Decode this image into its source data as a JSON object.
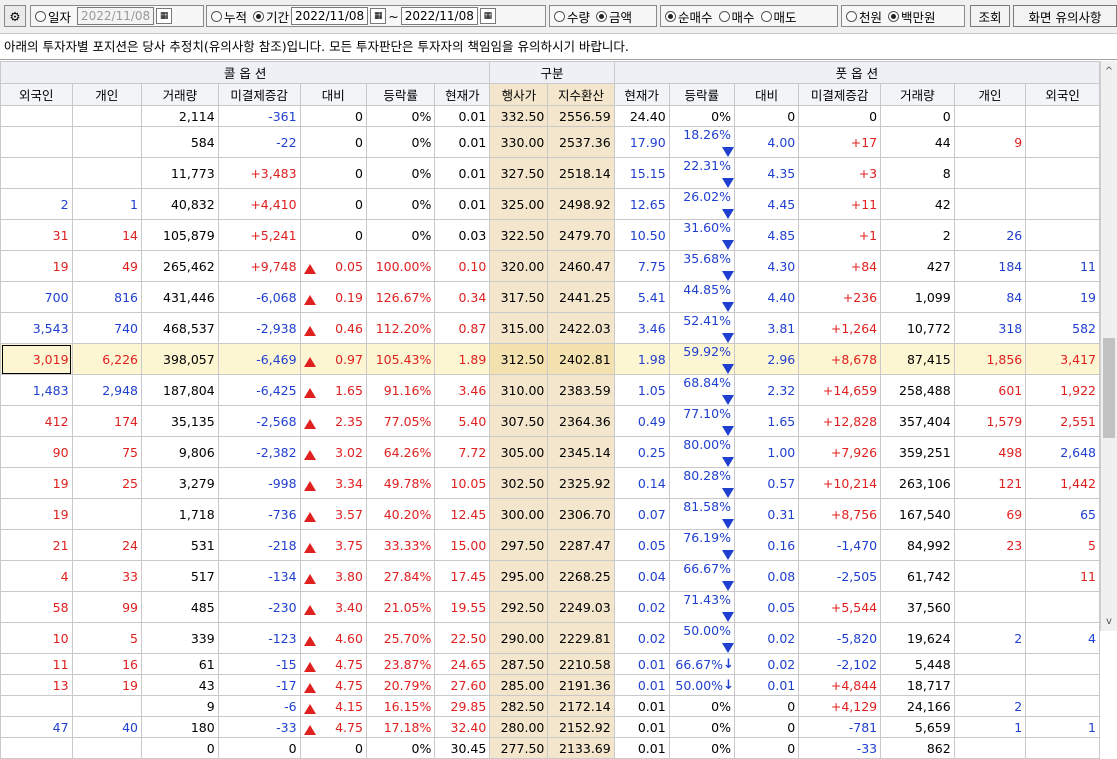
{
  "toolbar": {
    "gear_icon": "⚙",
    "period_daily": "일자",
    "date_single": "2022/11/08",
    "period_cumulative": "누적",
    "period_range": "기간",
    "date_from": "2022/11/08",
    "tilde": "~",
    "date_to": "2022/11/08",
    "unit_qty": "수량",
    "unit_amount": "금액",
    "trade_net": "순매수",
    "trade_buy": "매수",
    "trade_sell": "매도",
    "money_krw": "천원",
    "money_million": "백만원",
    "query_button": "조회",
    "notes_button": "화면 유의사항"
  },
  "notice": "아래의 투자자별 포지션은 당사 추정치(유의사항 참조)입니다. 모든 투자판단은 투자자의 책임임을 유의하시기 바랍니다.",
  "headers": {
    "call": "콜 옵 션",
    "mid": "구분",
    "put": "풋 옵 션",
    "cols": [
      "외국인",
      "개인",
      "거래량",
      "미결제증감",
      "대비",
      "등락률",
      "현재가",
      "행사가",
      "지수환산",
      "현재가",
      "등락률",
      "대비",
      "미결제증감",
      "거래량",
      "개인",
      "외국인"
    ]
  },
  "rows": [
    {
      "cf": "",
      "ci": "",
      "cv": "2,114",
      "coi": "-361",
      "cd": "0",
      "cdir": "",
      "cr": "0%",
      "cp": "0.01",
      "k": "332.50",
      "idx": "2556.59",
      "pp": "24.40",
      "pr": "0%",
      "pdir": "",
      "pd": "0",
      "poi": "0",
      "pv": "0",
      "pi": "",
      "pf": ""
    },
    {
      "cf": "",
      "ci": "",
      "cv": "584",
      "coi": "-22",
      "cd": "0",
      "cdir": "",
      "cr": "0%",
      "cp": "0.01",
      "k": "330.00",
      "idx": "2537.36",
      "pp": "17.90",
      "pr": "18.26%",
      "pdir": "down",
      "pd": "4.00",
      "poi": "+17",
      "pv": "44",
      "pi": "9",
      "pf": ""
    },
    {
      "cf": "",
      "ci": "",
      "cv": "11,773",
      "coi": "+3,483",
      "cd": "0",
      "cdir": "",
      "cr": "0%",
      "cp": "0.01",
      "k": "327.50",
      "idx": "2518.14",
      "pp": "15.15",
      "pr": "22.31%",
      "pdir": "down",
      "pd": "4.35",
      "poi": "+3",
      "pv": "8",
      "pi": "",
      "pf": ""
    },
    {
      "cf": "2",
      "ci": "1",
      "cv": "40,832",
      "coi": "+4,410",
      "cd": "0",
      "cdir": "",
      "cr": "0%",
      "cp": "0.01",
      "k": "325.00",
      "idx": "2498.92",
      "pp": "12.65",
      "pr": "26.02%",
      "pdir": "down",
      "pd": "4.45",
      "poi": "+11",
      "pv": "42",
      "pi": "",
      "pf": ""
    },
    {
      "cf": "31",
      "ci": "14",
      "cv": "105,879",
      "coi": "+5,241",
      "cd": "0",
      "cdir": "",
      "cr": "0%",
      "cp": "0.03",
      "k": "322.50",
      "idx": "2479.70",
      "pp": "10.50",
      "pr": "31.60%",
      "pdir": "down",
      "pd": "4.85",
      "poi": "+1",
      "pv": "2",
      "pi": "26",
      "pf": ""
    },
    {
      "cf": "19",
      "ci": "49",
      "cv": "265,462",
      "coi": "+9,748",
      "cd": "0.05",
      "cdir": "up",
      "cr": "100.00%",
      "cp": "0.10",
      "k": "320.00",
      "idx": "2460.47",
      "pp": "7.75",
      "pr": "35.68%",
      "pdir": "down",
      "pd": "4.30",
      "poi": "+84",
      "pv": "427",
      "pi": "184",
      "pf": "11"
    },
    {
      "cf": "700",
      "ci": "816",
      "cv": "431,446",
      "coi": "-6,068",
      "cd": "0.19",
      "cdir": "up",
      "cr": "126.67%",
      "cp": "0.34",
      "k": "317.50",
      "idx": "2441.25",
      "pp": "5.41",
      "pr": "44.85%",
      "pdir": "down",
      "pd": "4.40",
      "poi": "+236",
      "pv": "1,099",
      "pi": "84",
      "pf": "19"
    },
    {
      "cf": "3,543",
      "ci": "740",
      "cv": "468,537",
      "coi": "-2,938",
      "cd": "0.46",
      "cdir": "up",
      "cr": "112.20%",
      "cp": "0.87",
      "k": "315.00",
      "idx": "2422.03",
      "pp": "3.46",
      "pr": "52.41%",
      "pdir": "down",
      "pd": "3.81",
      "poi": "+1,264",
      "pv": "10,772",
      "pi": "318",
      "pf": "582"
    },
    {
      "cf": "3,019",
      "ci": "6,226",
      "cv": "398,057",
      "coi": "-6,469",
      "cd": "0.97",
      "cdir": "up",
      "cr": "105.43%",
      "cp": "1.89",
      "k": "312.50",
      "idx": "2402.81",
      "pp": "1.98",
      "pr": "59.92%",
      "pdir": "down",
      "pd": "2.96",
      "poi": "+8,678",
      "pv": "87,415",
      "pi": "1,856",
      "pf": "3,417"
    },
    {
      "cf": "1,483",
      "ci": "2,948",
      "cv": "187,804",
      "coi": "-6,425",
      "cd": "1.65",
      "cdir": "up",
      "cr": "91.16%",
      "cp": "3.46",
      "k": "310.00",
      "idx": "2383.59",
      "pp": "1.05",
      "pr": "68.84%",
      "pdir": "down",
      "pd": "2.32",
      "poi": "+14,659",
      "pv": "258,488",
      "pi": "601",
      "pf": "1,922"
    },
    {
      "cf": "412",
      "ci": "174",
      "cv": "35,135",
      "coi": "-2,568",
      "cd": "2.35",
      "cdir": "up",
      "cr": "77.05%",
      "cp": "5.40",
      "k": "307.50",
      "idx": "2364.36",
      "pp": "0.49",
      "pr": "77.10%",
      "pdir": "down",
      "pd": "1.65",
      "poi": "+12,828",
      "pv": "357,404",
      "pi": "1,579",
      "pf": "2,551"
    },
    {
      "cf": "90",
      "ci": "75",
      "cv": "9,806",
      "coi": "-2,382",
      "cd": "3.02",
      "cdir": "up",
      "cr": "64.26%",
      "cp": "7.72",
      "k": "305.00",
      "idx": "2345.14",
      "pp": "0.25",
      "pr": "80.00%",
      "pdir": "down",
      "pd": "1.00",
      "poi": "+7,926",
      "pv": "359,251",
      "pi": "498",
      "pf": "2,648"
    },
    {
      "cf": "19",
      "ci": "25",
      "cv": "3,279",
      "coi": "-998",
      "cd": "3.34",
      "cdir": "up",
      "cr": "49.78%",
      "cp": "10.05",
      "k": "302.50",
      "idx": "2325.92",
      "pp": "0.14",
      "pr": "80.28%",
      "pdir": "down",
      "pd": "0.57",
      "poi": "+10,214",
      "pv": "263,106",
      "pi": "121",
      "pf": "1,442"
    },
    {
      "cf": "19",
      "ci": "",
      "cv": "1,718",
      "coi": "-736",
      "cd": "3.57",
      "cdir": "up",
      "cr": "40.20%",
      "cp": "12.45",
      "k": "300.00",
      "idx": "2306.70",
      "pp": "0.07",
      "pr": "81.58%",
      "pdir": "down",
      "pd": "0.31",
      "poi": "+8,756",
      "pv": "167,540",
      "pi": "69",
      "pf": "65"
    },
    {
      "cf": "21",
      "ci": "24",
      "cv": "531",
      "coi": "-218",
      "cd": "3.75",
      "cdir": "up",
      "cr": "33.33%",
      "cp": "15.00",
      "k": "297.50",
      "idx": "2287.47",
      "pp": "0.05",
      "pr": "76.19%",
      "pdir": "down",
      "pd": "0.16",
      "poi": "-1,470",
      "pv": "84,992",
      "pi": "23",
      "pf": "5"
    },
    {
      "cf": "4",
      "ci": "33",
      "cv": "517",
      "coi": "-134",
      "cd": "3.80",
      "cdir": "up",
      "cr": "27.84%",
      "cp": "17.45",
      "k": "295.00",
      "idx": "2268.25",
      "pp": "0.04",
      "pr": "66.67%",
      "pdir": "down",
      "pd": "0.08",
      "poi": "-2,505",
      "pv": "61,742",
      "pi": "",
      "pf": "11"
    },
    {
      "cf": "58",
      "ci": "99",
      "cv": "485",
      "coi": "-230",
      "cd": "3.40",
      "cdir": "up",
      "cr": "21.05%",
      "cp": "19.55",
      "k": "292.50",
      "idx": "2249.03",
      "pp": "0.02",
      "pr": "71.43%",
      "pdir": "down",
      "pd": "0.05",
      "poi": "+5,544",
      "pv": "37,560",
      "pi": "",
      "pf": ""
    },
    {
      "cf": "10",
      "ci": "5",
      "cv": "339",
      "coi": "-123",
      "cd": "4.60",
      "cdir": "up",
      "cr": "25.70%",
      "cp": "22.50",
      "k": "290.00",
      "idx": "2229.81",
      "pp": "0.02",
      "pr": "50.00%",
      "pdir": "down",
      "pd": "0.02",
      "poi": "-5,820",
      "pv": "19,624",
      "pi": "2",
      "pf": "4"
    },
    {
      "cf": "11",
      "ci": "16",
      "cv": "61",
      "coi": "-15",
      "cd": "4.75",
      "cdir": "up",
      "cr": "23.87%",
      "cp": "24.65",
      "k": "287.50",
      "idx": "2210.58",
      "pp": "0.01",
      "pr": "66.67%",
      "pdir": "arrow",
      "pd": "0.02",
      "poi": "-2,102",
      "pv": "5,448",
      "pi": "",
      "pf": ""
    },
    {
      "cf": "13",
      "ci": "19",
      "cv": "43",
      "coi": "-17",
      "cd": "4.75",
      "cdir": "up",
      "cr": "20.79%",
      "cp": "27.60",
      "k": "285.00",
      "idx": "2191.36",
      "pp": "0.01",
      "pr": "50.00%",
      "pdir": "arrow",
      "pd": "0.01",
      "poi": "+4,844",
      "pv": "18,717",
      "pi": "",
      "pf": ""
    },
    {
      "cf": "",
      "ci": "",
      "cv": "9",
      "coi": "-6",
      "cd": "4.15",
      "cdir": "up",
      "cr": "16.15%",
      "cp": "29.85",
      "k": "282.50",
      "idx": "2172.14",
      "pp": "0.01",
      "pr": "0%",
      "pdir": "",
      "pd": "0",
      "poi": "+4,129",
      "pv": "24,166",
      "pi": "2",
      "pf": ""
    },
    {
      "cf": "47",
      "ci": "40",
      "cv": "180",
      "coi": "-33",
      "cd": "4.75",
      "cdir": "up",
      "cr": "17.18%",
      "cp": "32.40",
      "k": "280.00",
      "idx": "2152.92",
      "pp": "0.01",
      "pr": "0%",
      "pdir": "",
      "pd": "0",
      "poi": "-781",
      "pv": "5,659",
      "pi": "1",
      "pf": "1"
    },
    {
      "cf": "",
      "ci": "",
      "cv": "0",
      "coi": "0",
      "cd": "0",
      "cdir": "",
      "cr": "0%",
      "cp": "30.45",
      "k": "277.50",
      "idx": "2133.69",
      "pp": "0.01",
      "pr": "0%",
      "pdir": "",
      "pd": "0",
      "poi": "-33",
      "pv": "862",
      "pi": "",
      "pf": ""
    }
  ],
  "colors": {
    "up": "#e0201f",
    "down": "#1f3fd0",
    "strike_bg": "#f3e6cd",
    "highlight_bg": "#fdf6d2"
  },
  "highlight_row": 8
}
